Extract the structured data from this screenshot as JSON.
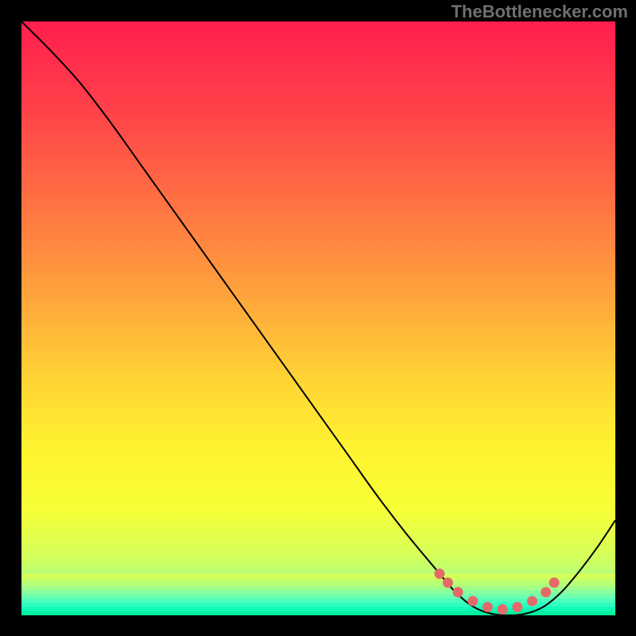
{
  "watermark": "TheBottlenecker.com",
  "chart_data": {
    "type": "line",
    "title": "",
    "xlabel": "",
    "ylabel": "",
    "xlim": [
      0,
      100
    ],
    "ylim": [
      0,
      100
    ],
    "grid": false,
    "axes_visible": false,
    "series": [
      {
        "name": "main-curve",
        "color": "#000000",
        "x": [
          0,
          5,
          10,
          15,
          20,
          25,
          30,
          35,
          40,
          45,
          50,
          55,
          60,
          65,
          70,
          73,
          76,
          79,
          82,
          85,
          88,
          91,
          94,
          97,
          100
        ],
        "y": [
          100,
          95,
          89.5,
          83,
          76,
          69,
          62,
          55,
          48,
          41,
          34,
          27,
          20,
          13.5,
          7.5,
          4,
          1.5,
          0.3,
          0,
          0.3,
          1.5,
          4,
          7.5,
          11.5,
          16
        ]
      },
      {
        "name": "highlight-dots",
        "color": "#e46a6a",
        "marker": "circle",
        "x": [
          70.4,
          71.8,
          73.5,
          76.0,
          78.5,
          81.0,
          83.5,
          86.0,
          88.3,
          89.7
        ],
        "y": [
          7.0,
          5.5,
          3.9,
          2.4,
          1.4,
          1.0,
          1.4,
          2.4,
          3.9,
          5.5
        ]
      }
    ],
    "background_gradient": {
      "type": "vertical",
      "stops": [
        {
          "pos": 0.0,
          "color": "#ff1e4e"
        },
        {
          "pos": 0.15,
          "color": "#ff4249"
        },
        {
          "pos": 0.3,
          "color": "#ff7043"
        },
        {
          "pos": 0.45,
          "color": "#ffa03c"
        },
        {
          "pos": 0.6,
          "color": "#ffd335"
        },
        {
          "pos": 0.72,
          "color": "#fff32f"
        },
        {
          "pos": 0.82,
          "color": "#f7ff36"
        },
        {
          "pos": 0.9,
          "color": "#d5ff5a"
        },
        {
          "pos": 0.935,
          "color": "#b3ff7a"
        },
        {
          "pos": 0.955,
          "color": "#8cffa0"
        },
        {
          "pos": 0.97,
          "color": "#5cffbb"
        },
        {
          "pos": 0.985,
          "color": "#2affc3"
        },
        {
          "pos": 1.0,
          "color": "#00ef9d"
        }
      ]
    },
    "bottom_stripes": [
      {
        "y0": 0.93,
        "y1": 0.937,
        "color": "#d7ff57"
      },
      {
        "y0": 0.937,
        "y1": 0.944,
        "color": "#c6ff66"
      },
      {
        "y0": 0.944,
        "y1": 0.951,
        "color": "#b4ff76"
      },
      {
        "y0": 0.951,
        "y1": 0.958,
        "color": "#9fff8a"
      },
      {
        "y0": 0.958,
        "y1": 0.965,
        "color": "#86ffa0"
      },
      {
        "y0": 0.965,
        "y1": 0.972,
        "color": "#6bffb0"
      },
      {
        "y0": 0.972,
        "y1": 0.979,
        "color": "#4dffbc"
      },
      {
        "y0": 0.979,
        "y1": 0.986,
        "color": "#2dffc0"
      },
      {
        "y0": 0.986,
        "y1": 0.993,
        "color": "#10fab5"
      },
      {
        "y0": 0.993,
        "y1": 1.0,
        "color": "#00ef9d"
      }
    ]
  }
}
